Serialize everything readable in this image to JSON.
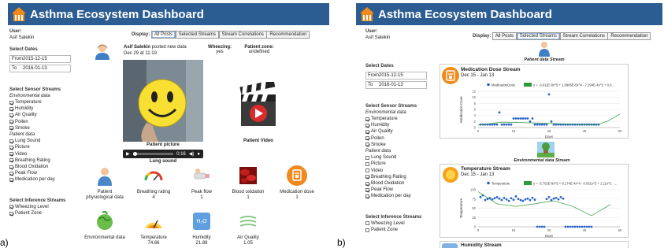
{
  "app_title": "Asthma Ecosystem Dashboard",
  "figure_labels": [
    "a)",
    "b)"
  ],
  "sidebar": {
    "user_label": "User:",
    "user_name": "Asif Salekin",
    "select_dates_label": "Select Dates",
    "from_label": "From",
    "from_value": "2015-12-15",
    "to_label": "To",
    "to_value": "2016-01-13",
    "sensor_streams_label": "Select Sensor Streams",
    "environmental_label": "Environmental data",
    "patient_label": "Patient data",
    "inference_label": "Select Inference Streams"
  },
  "panel_a": {
    "env_items": [
      {
        "label": "Temperature",
        "checked": true
      },
      {
        "label": "Humidity",
        "checked": true
      },
      {
        "label": "Air Quality",
        "checked": true
      },
      {
        "label": "Pollen",
        "checked": true
      },
      {
        "label": "Smoke",
        "checked": true
      }
    ],
    "patient_items": [
      {
        "label": "Lung Sound",
        "checked": true
      },
      {
        "label": "Picture",
        "checked": true
      },
      {
        "label": "Video",
        "checked": true
      },
      {
        "label": "Breathing Rating",
        "checked": true
      },
      {
        "label": "Blood Oxidation",
        "checked": true
      },
      {
        "label": "Peak Flow",
        "checked": true
      },
      {
        "label": "Medication per day",
        "checked": true
      }
    ],
    "inference_items": [
      {
        "label": "Wheezing Level",
        "checked": true
      },
      {
        "label": "Patient Zone",
        "checked": true
      }
    ],
    "display": {
      "label": "Display:",
      "buttons": [
        "All Posts",
        "Selected Streams",
        "Stream Correlations",
        "Recommendation"
      ],
      "selected": 0
    },
    "post": {
      "author": "Asif Salekin",
      "action": " posted new data",
      "time": "Dec 29 at 11:19",
      "wheezing_label": "Wheezing:",
      "wheezing_value": "yes",
      "zone_label": "Patient zone:",
      "zone_value": "undefined",
      "picture_caption": "Patient picture",
      "video_caption": "Patient Video",
      "player_time": "0:16",
      "lung_caption": "Lung sound"
    },
    "tiles": [
      {
        "label": "Patient physiological data",
        "value": "",
        "icon": "person-icon"
      },
      {
        "label": "Breathing rating",
        "value": "4",
        "icon": "gauge-icon"
      },
      {
        "label": "Peak flow",
        "value": "1",
        "icon": "peak-flow-icon"
      },
      {
        "label": "Blood oxidation",
        "value": "1",
        "icon": "blood-cells-icon"
      },
      {
        "label": "Medication dose",
        "value": "1",
        "icon": "medication-icon"
      },
      {
        "label": "Environmental data",
        "value": "",
        "icon": "globe-icon"
      },
      {
        "label": "Temperature",
        "value": "74.66",
        "icon": "thermometer-icon"
      },
      {
        "label": "Humidity",
        "value": "21.88",
        "icon": "humidity-icon"
      },
      {
        "label": "Air Quality",
        "value": "1.05",
        "icon": "wind-icon"
      }
    ]
  },
  "panel_b": {
    "env_items": [
      {
        "label": "Temperature",
        "checked": true
      },
      {
        "label": "Humidity",
        "checked": true
      },
      {
        "label": "Air Quality",
        "checked": true
      },
      {
        "label": "Pollen",
        "checked": true
      },
      {
        "label": "Smoke",
        "checked": true
      }
    ],
    "patient_items": [
      {
        "label": "Lung Sound",
        "checked": false
      },
      {
        "label": "Picture",
        "checked": false
      },
      {
        "label": "Video",
        "checked": false
      },
      {
        "label": "Breathing Rating",
        "checked": true
      },
      {
        "label": "Blood Oxidation",
        "checked": true
      },
      {
        "label": "Peak Flow",
        "checked": true
      },
      {
        "label": "Medication per day",
        "checked": true
      }
    ],
    "inference_items": [
      {
        "label": "Wheezing Level",
        "checked": false
      },
      {
        "label": "Patient Zone",
        "checked": false
      }
    ],
    "display": {
      "label": "Display:",
      "buttons": [
        "All Posts",
        "Selected Streams",
        "Stream Correlations",
        "Recommendation"
      ],
      "selected": 1
    },
    "patient_stream_label": "Patient data Stream",
    "environmental_stream_label": "Environmental data Stream",
    "medication_stream": {
      "title": "Medication Dose Stream",
      "range": "Dec 15 - Jan 13"
    },
    "temperature_stream": {
      "title": "Temperature Stream",
      "range": "Dec 15 - Jan 13"
    },
    "humidity_stream": {
      "title": "Humidity Stream"
    }
  },
  "chart_data": [
    {
      "type": "scatter",
      "title": "Medication Dose Stream",
      "xlabel": "Days",
      "ylabel": "Medication Dose",
      "xlim": [
        0,
        60
      ],
      "ylim": [
        0,
        12
      ],
      "xticks": [
        0,
        15,
        30,
        45,
        60
      ],
      "yticks": [
        0,
        2,
        4,
        6,
        8,
        10,
        12
      ],
      "series": [
        {
          "name": "MedicationDose",
          "color": "#2a62c9",
          "x": [
            1,
            2,
            3,
            4,
            5,
            6,
            7,
            8,
            9,
            10,
            11,
            12,
            13,
            14,
            15,
            16,
            17,
            18,
            19,
            20,
            21,
            22,
            23,
            24,
            25,
            26,
            27,
            28,
            29,
            30,
            31,
            32,
            33,
            34,
            35,
            36,
            37,
            38,
            39,
            40,
            41,
            42,
            43,
            44,
            45,
            46,
            47,
            48,
            49,
            50,
            51
          ],
          "y": [
            1,
            1,
            1,
            1,
            1,
            1,
            1,
            1,
            5,
            1,
            1,
            1,
            1,
            1,
            3,
            3,
            3,
            3,
            3,
            3,
            3,
            2,
            3,
            1,
            1,
            1,
            1,
            1,
            1,
            11,
            2,
            1,
            1,
            1,
            1,
            1,
            1,
            1,
            1,
            1,
            1,
            1,
            1,
            1,
            1,
            1,
            1,
            1,
            1,
            1,
            1
          ]
        },
        {
          "name": "y = -3.011E-8x^5 + 1.0985E-5x^4 - 7.294E-4x^3 + 0.0...",
          "color": "#2f9a3a",
          "trend": true,
          "x": [
            0,
            10,
            20,
            30,
            40,
            50,
            55,
            60
          ],
          "y": [
            0.8,
            1.8,
            1.6,
            1.4,
            1.1,
            0.8,
            2.2,
            4.5
          ]
        }
      ]
    },
    {
      "type": "scatter",
      "title": "Temperature Stream",
      "xlabel": "Days",
      "ylabel": "Temperature",
      "xlim": [
        0,
        60
      ],
      "ylim": [
        0,
        100
      ],
      "xticks": [
        0,
        15,
        30,
        45,
        60
      ],
      "yticks": [
        0,
        25,
        50,
        75,
        100
      ],
      "series": [
        {
          "name": "Temperature",
          "color": "#2a62c9",
          "x": [
            1,
            2,
            3,
            4,
            5,
            6,
            7,
            8,
            9,
            10,
            11,
            12,
            13,
            14,
            15,
            16,
            17,
            18,
            19,
            20,
            21,
            22,
            23,
            24,
            25,
            26,
            27,
            28,
            29,
            30,
            31,
            32,
            33,
            34,
            35,
            36,
            37,
            38,
            39,
            40,
            41,
            42,
            43,
            44,
            45,
            46,
            47,
            48
          ],
          "y": [
            80,
            85,
            72,
            75,
            78,
            74,
            77,
            80,
            76,
            72,
            78,
            74,
            70,
            77,
            73,
            82,
            75,
            72,
            70,
            74,
            76,
            72,
            78,
            73,
            0,
            0,
            0,
            0,
            75,
            80,
            72,
            76,
            78,
            74,
            80,
            76,
            0,
            0,
            0,
            0,
            0,
            0,
            0,
            0,
            0,
            0,
            0,
            0
          ]
        },
        {
          "name": "y = -5.702E-8x^5 + 8.174E-4x^4 - 0.051x^3 + 1.11x^2 - ...",
          "color": "#2f9a3a",
          "trend": true,
          "x": [
            0,
            8,
            16,
            24,
            32,
            40,
            48,
            56
          ],
          "y": [
            95,
            62,
            55,
            62,
            70,
            55,
            30,
            60
          ]
        }
      ]
    }
  ]
}
